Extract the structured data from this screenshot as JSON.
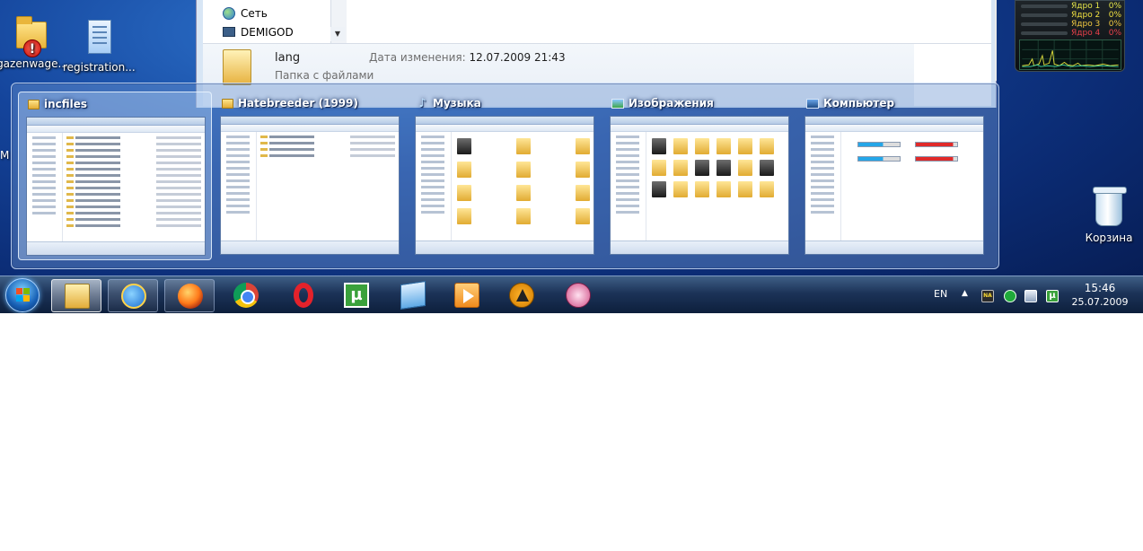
{
  "desktop": {
    "icons": [
      {
        "label": "gazenwage...",
        "icon": "folder-with-error-icon"
      },
      {
        "label": "registration...",
        "icon": "document-icon"
      }
    ],
    "side_letter": "M",
    "recycle_bin": {
      "label": "Корзина",
      "icon": "recycle-bin-icon"
    }
  },
  "background_window": {
    "nav_items": [
      {
        "label": "Сеть",
        "icon": "network-icon"
      },
      {
        "label": "DEMIGOD",
        "icon": "computer-icon"
      }
    ],
    "file_row": {
      "name": "lang",
      "type": "Папка с файлами",
      "modified_label": "Дата изменения:",
      "modified_value": "12.07.2009 21:43"
    }
  },
  "cpu_gadget": {
    "cores": [
      {
        "label": "Ядро 1",
        "percent": "0%",
        "color": "#e6e64a"
      },
      {
        "label": "Ядро 2",
        "percent": "0%",
        "color": "#f0e040"
      },
      {
        "label": "Ядро 3",
        "percent": "0%",
        "color": "#f0c840"
      },
      {
        "label": "Ядро 4",
        "percent": "0%",
        "color": "#e8404a"
      }
    ]
  },
  "peek": {
    "thumbnails": [
      {
        "title": "incfiles",
        "icon": "folder-icon",
        "active": true,
        "layout": "list"
      },
      {
        "title": "Hatebreeder (1999)",
        "icon": "folder-icon",
        "active": false,
        "layout": "list"
      },
      {
        "title": "Музыка",
        "icon": "music-icon",
        "active": false,
        "layout": "grid"
      },
      {
        "title": "Изображения",
        "icon": "image-icon",
        "active": false,
        "layout": "grid"
      },
      {
        "title": "Компьютер",
        "icon": "computer-icon",
        "active": false,
        "layout": "drives"
      }
    ]
  },
  "taskbar": {
    "start": "start-orb-icon",
    "buttons": [
      {
        "app": "windows-explorer",
        "icon": "explorer-icon",
        "state": "hot"
      },
      {
        "app": "internet-explorer",
        "icon": "ie-icon",
        "state": "open"
      },
      {
        "app": "firefox",
        "icon": "firefox-icon",
        "state": "open"
      },
      {
        "app": "chrome",
        "icon": "chrome-icon",
        "state": "pinned"
      },
      {
        "app": "opera",
        "icon": "opera-icon",
        "state": "pinned"
      },
      {
        "app": "utorrent",
        "icon": "utorrent-icon",
        "state": "pinned",
        "glyph": "µ"
      },
      {
        "app": "documents",
        "icon": "documents-icon",
        "state": "pinned"
      },
      {
        "app": "media-player",
        "icon": "media-player-icon",
        "state": "pinned"
      },
      {
        "app": "aimp",
        "icon": "aimp-icon",
        "state": "pinned"
      },
      {
        "app": "snipping-tool",
        "icon": "snipping-tool-icon",
        "state": "pinned"
      }
    ],
    "tray": {
      "language": "EN",
      "expand_arrow": "▲",
      "na_badge": "NA",
      "utorrent_glyph": "µ",
      "time": "15:46",
      "date": "25.07.2009"
    }
  }
}
